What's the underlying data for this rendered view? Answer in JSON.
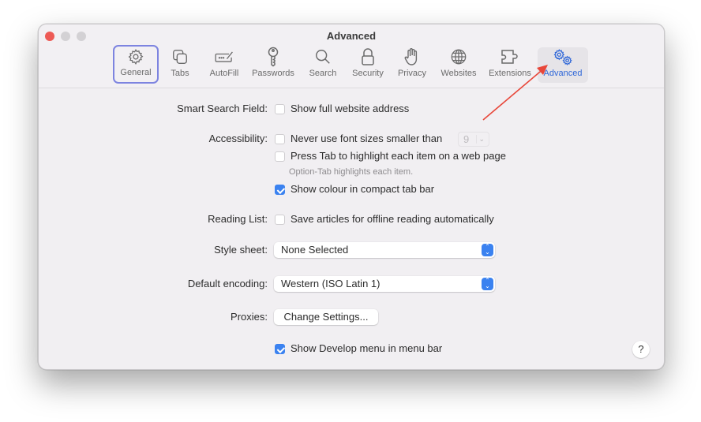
{
  "window": {
    "title": "Advanced",
    "traffic_lights": [
      "close",
      "minimize",
      "zoom"
    ]
  },
  "toolbar": {
    "tabs": [
      {
        "label": "General",
        "icon": "gear-icon",
        "highlighted": true
      },
      {
        "label": "Tabs",
        "icon": "tabs-icon"
      },
      {
        "label": "AutoFill",
        "icon": "autofill-icon"
      },
      {
        "label": "Passwords",
        "icon": "key-icon"
      },
      {
        "label": "Search",
        "icon": "search-icon"
      },
      {
        "label": "Security",
        "icon": "lock-icon"
      },
      {
        "label": "Privacy",
        "icon": "hand-icon"
      },
      {
        "label": "Websites",
        "icon": "globe-icon"
      },
      {
        "label": "Extensions",
        "icon": "puzzle-icon"
      },
      {
        "label": "Advanced",
        "icon": "gears-icon",
        "selected": true
      }
    ],
    "accent_color": "#2f67d8",
    "highlight_border_color": "#7d84e0"
  },
  "annotation": {
    "arrow_color": "#e8473a"
  },
  "settings": {
    "smart_search": {
      "label": "Smart Search Field:",
      "option": "Show full website address",
      "checked": false
    },
    "accessibility": {
      "label": "Accessibility:",
      "font_size_option": "Never use font sizes smaller than",
      "font_size_checked": false,
      "font_size_value": "9",
      "tab_option": "Press Tab to highlight each item on a web page",
      "tab_checked": false,
      "tab_hint": "Option-Tab highlights each item.",
      "colour_option": "Show colour in compact tab bar",
      "colour_checked": true
    },
    "reading_list": {
      "label": "Reading List:",
      "option": "Save articles for offline reading automatically",
      "checked": false
    },
    "style_sheet": {
      "label": "Style sheet:",
      "value": "None Selected"
    },
    "encoding": {
      "label": "Default encoding:",
      "value": "Western (ISO Latin 1)"
    },
    "proxies": {
      "label": "Proxies:",
      "button": "Change Settings..."
    },
    "develop": {
      "option": "Show Develop menu in menu bar",
      "checked": true
    },
    "help_label": "?"
  }
}
